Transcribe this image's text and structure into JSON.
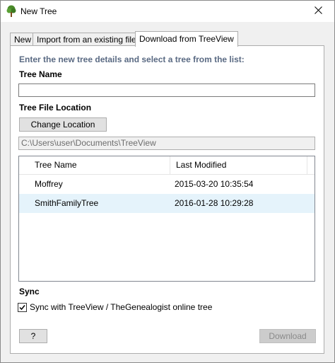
{
  "window": {
    "title": "New Tree",
    "app_icon": "tree-icon",
    "close_icon": "close-icon"
  },
  "tabs": [
    {
      "label": "New"
    },
    {
      "label": "Import from an existing file"
    },
    {
      "label": "Download from TreeView",
      "active": true
    }
  ],
  "form": {
    "instructions": "Enter the new tree details and select a tree from the list:",
    "tree_name_label": "Tree Name",
    "tree_name_value": "",
    "location_label": "Tree File Location",
    "change_location_button": "Change Location",
    "location_path": "C:\\Users\\user\\Documents\\TreeView"
  },
  "table": {
    "columns": [
      "Tree Name",
      "Last Modified"
    ],
    "rows": [
      {
        "name": "Moffrey",
        "modified": "2015-03-20 10:35:54"
      },
      {
        "name": "SmithFamilyTree",
        "modified": "2016-01-28 10:29:28",
        "selected": true
      }
    ]
  },
  "sync": {
    "label": "Sync",
    "checkbox_label": "Sync with TreeView / TheGenealogist online tree",
    "checked": true
  },
  "footer": {
    "help_button": "?",
    "download_button": "Download",
    "download_enabled": false
  },
  "colors": {
    "instruction_text": "#5a6a83",
    "selected_row": "#e5f3fb",
    "app_icon_green": "#4a8a2a"
  }
}
